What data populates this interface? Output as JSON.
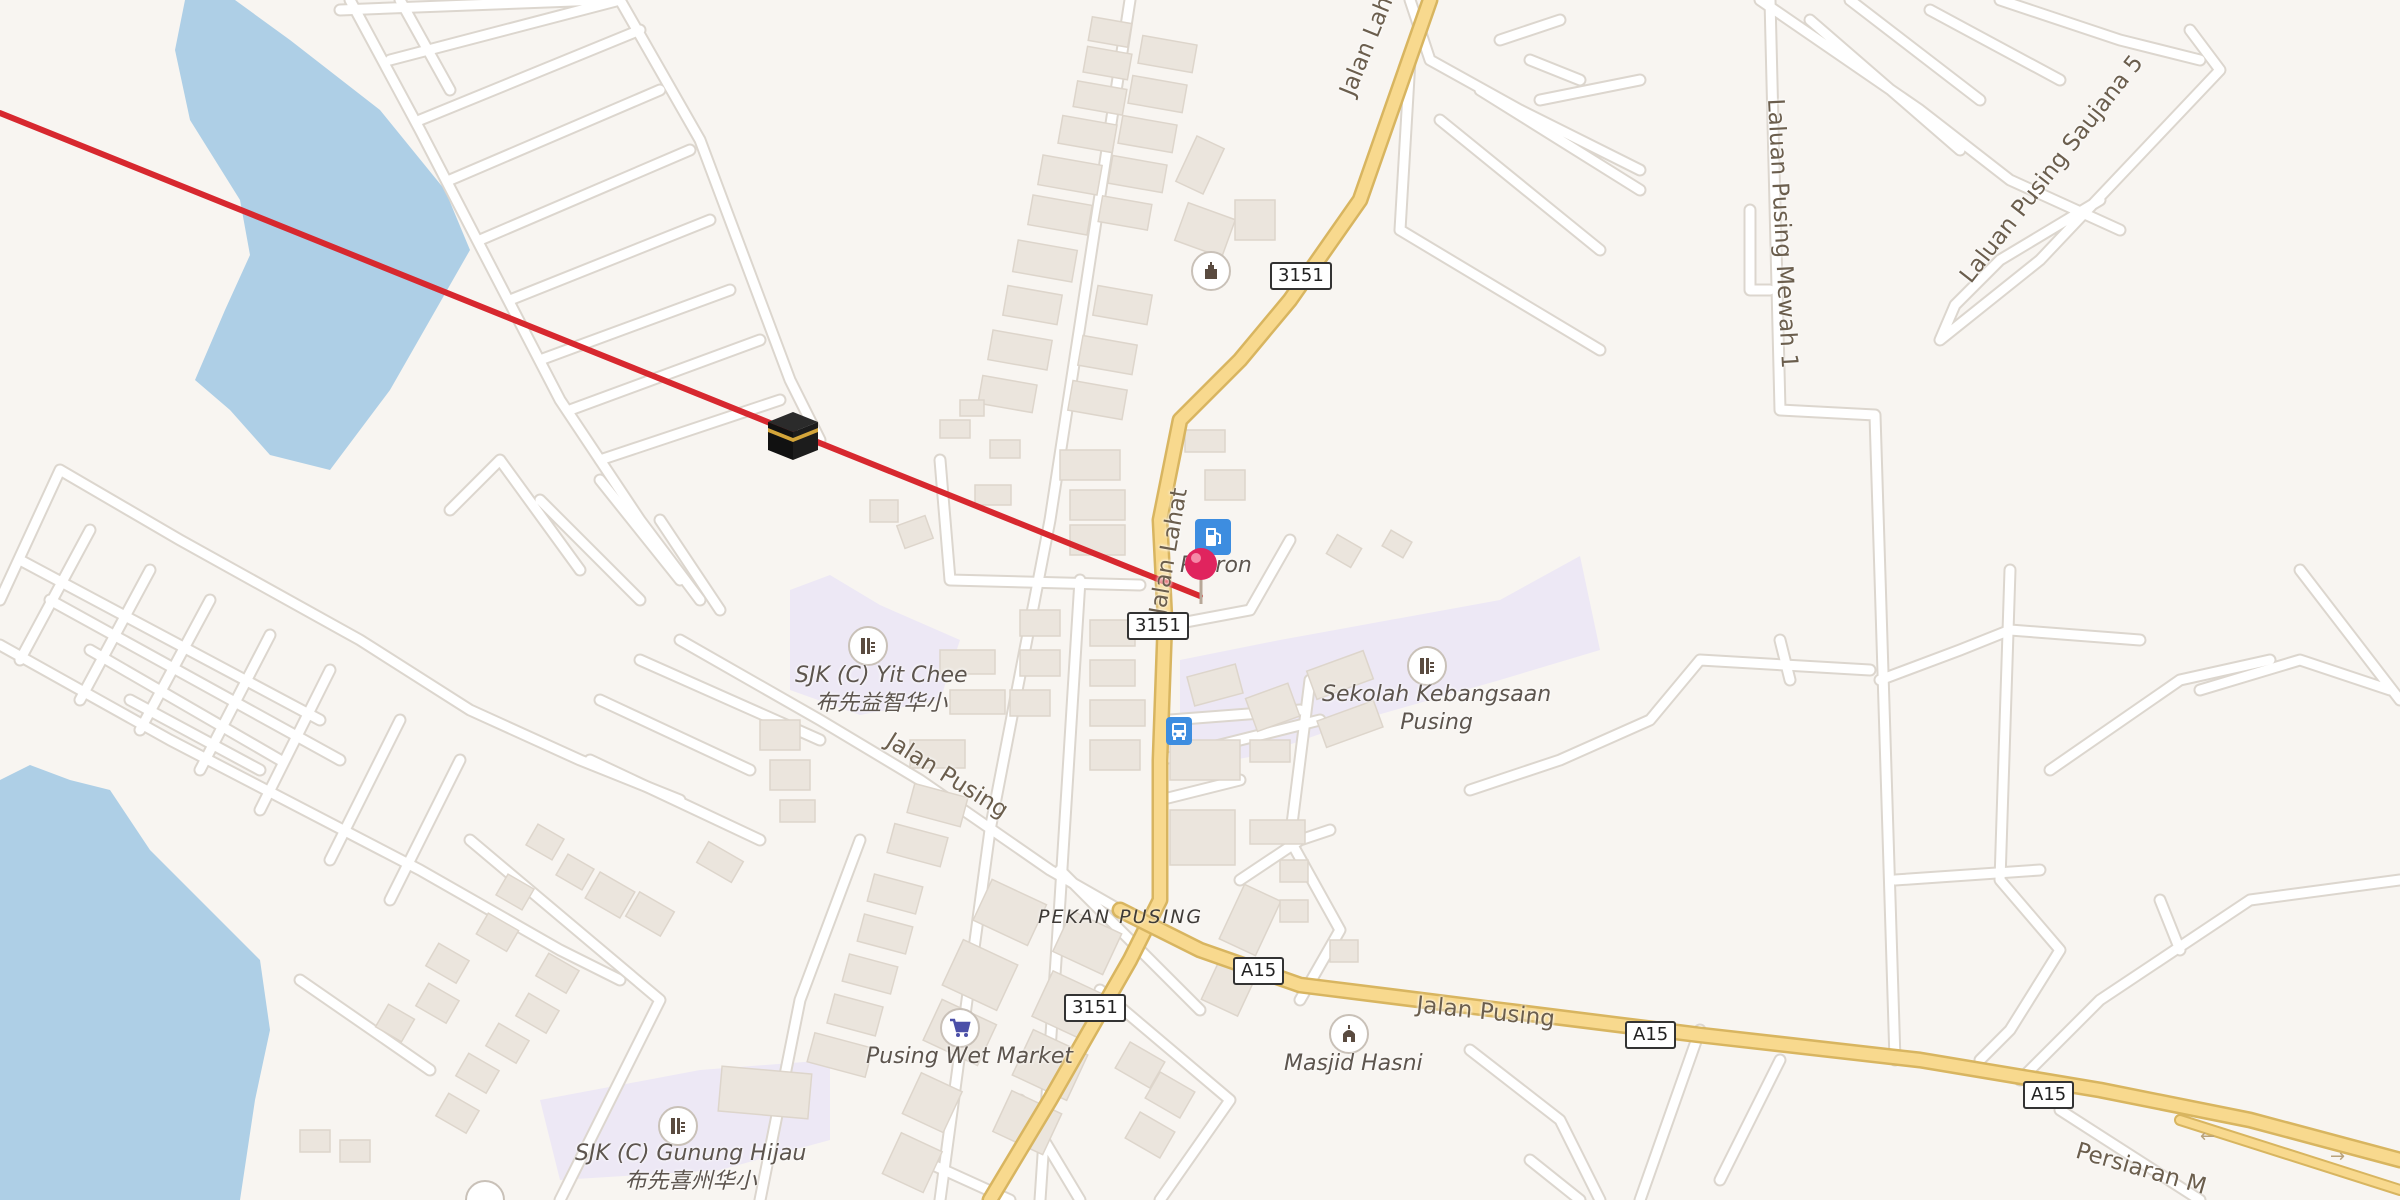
{
  "map": {
    "colors": {
      "background": "#f8f5f1",
      "water": "#aecfe6",
      "school_area": "#ede8f5",
      "main_road": "#f8d98e",
      "qibla_line": "#d7282f",
      "pin": "#e0245e"
    },
    "place_labels": {
      "pekan_pusing": "PEKAN PUSING"
    },
    "road_labels": {
      "jalan_lahat_north": "Jalan Lahat",
      "jalan_lahat_south": "Jalan Lahat",
      "jalan_pusing_west": "Jalan Pusing",
      "jalan_pusing_east": "Jalan Pusing",
      "laluan_pusing_mewah": "Laluan Pusing Mewah 1",
      "laluan_pusing_saujana": "Laluan Pusing Saujana 5",
      "persiaran": "Persiaran M"
    },
    "shields": {
      "r3151_a": "3151",
      "r3151_b": "3151",
      "r3151_c": "3151",
      "a15_a": "A15",
      "a15_b": "A15",
      "a15_c": "A15"
    },
    "pois": {
      "yit_chee": {
        "name": "SJK (C) Yit Chee",
        "name_cn": "布先益智华小",
        "icon": "school-icon"
      },
      "sekolah": {
        "line1": "Sekolah Kebangsaan",
        "line2": "Pusing",
        "icon": "school-icon"
      },
      "gunung_hijau": {
        "name": "SJK (C) Gunung Hijau",
        "name_cn": "布先喜州华小",
        "icon": "school-icon"
      },
      "wet_market": {
        "name": "Pusing Wet Market",
        "icon": "shopping-cart-icon"
      },
      "masjid": {
        "name": "Masjid Hasni",
        "icon": "mosque-icon"
      },
      "petron": {
        "name": "Petron",
        "icon": "fuel-pump-icon"
      },
      "bus_stop": {
        "icon": "bus-icon"
      },
      "temple": {
        "icon": "temple-icon"
      },
      "kaaba": {
        "icon": "kaaba-icon"
      },
      "location_pin": {
        "icon": "location-pin-icon"
      }
    }
  }
}
